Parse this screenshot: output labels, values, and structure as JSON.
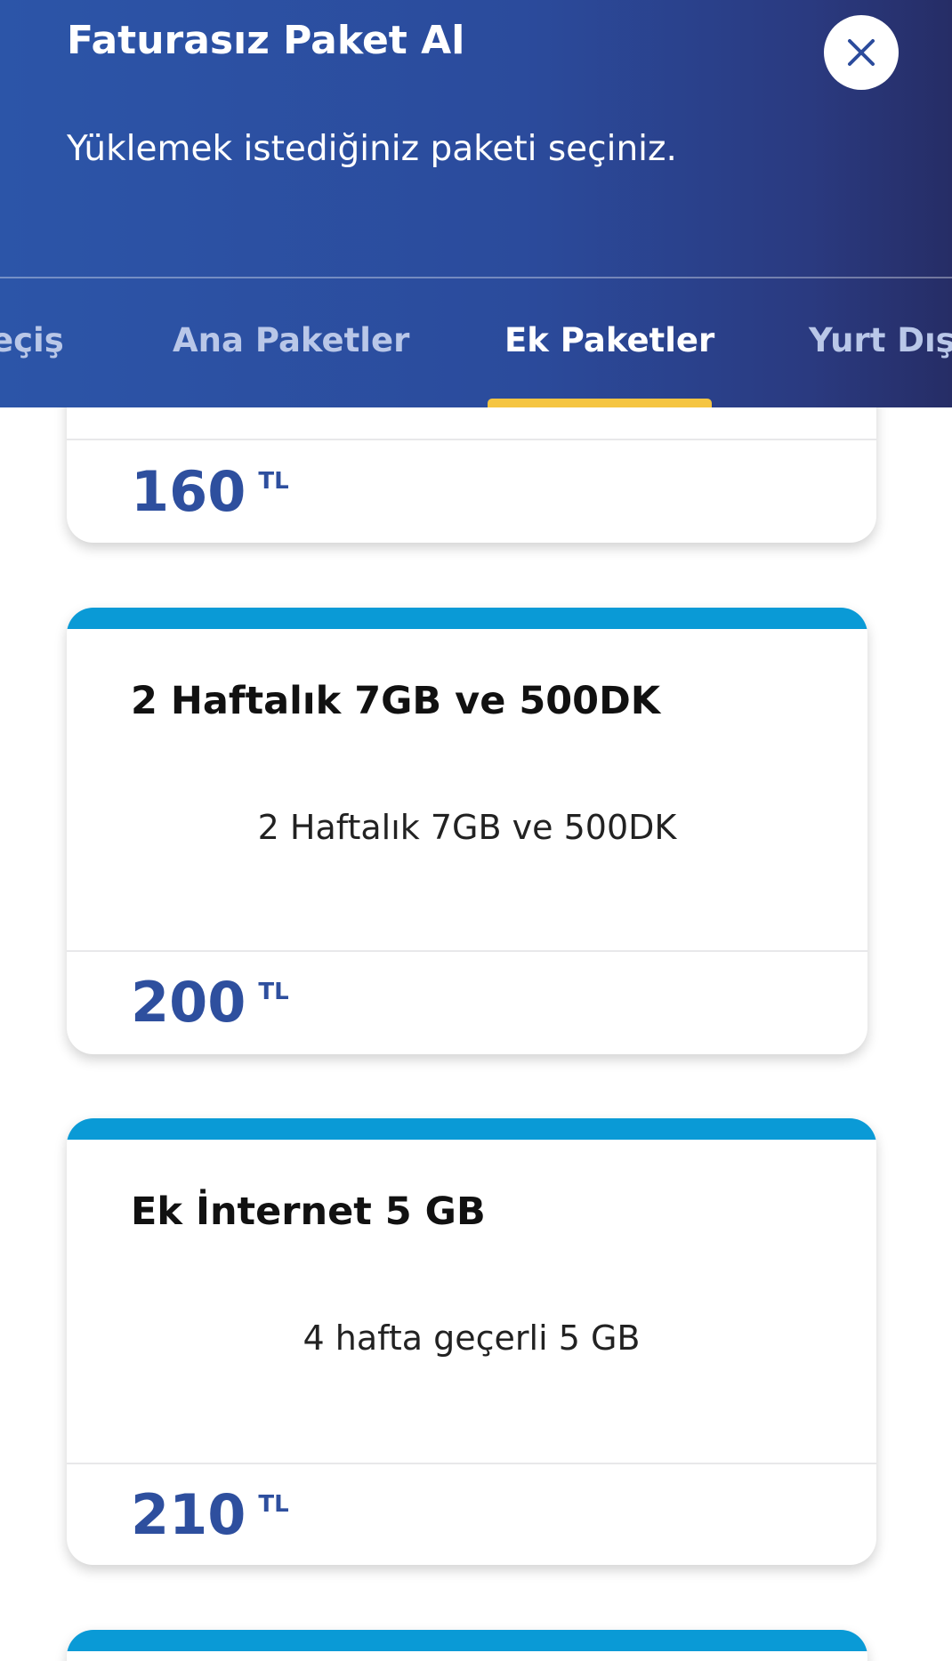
{
  "header": {
    "title": "Faturasız Paket Al",
    "subtitle": "Yüklemek istediğiniz paketi seçiniz.",
    "close_icon": "close-icon"
  },
  "tabs": [
    {
      "label": "eçiş",
      "active": false
    },
    {
      "label": "Ana Paketler",
      "active": false
    },
    {
      "label": "Ek Paketler",
      "active": true
    },
    {
      "label": "Yurt Dışı",
      "active": false
    }
  ],
  "packages": [
    {
      "title": "",
      "description": "",
      "price": "160",
      "currency": "TL"
    },
    {
      "title": "2 Haftalık 7GB ve 500DK",
      "description": "2 Haftalık 7GB ve 500DK",
      "price": "200",
      "currency": "TL"
    },
    {
      "title": "Ek İnternet 5 GB",
      "description": "4 hafta geçerli 5 GB",
      "price": "210",
      "currency": "TL"
    }
  ],
  "colors": {
    "header_start": "#2c55a8",
    "header_end": "#262d66",
    "tab_indicator": "#f5c542",
    "card_accent": "#0a9ad6",
    "price": "#2e4f9e"
  }
}
